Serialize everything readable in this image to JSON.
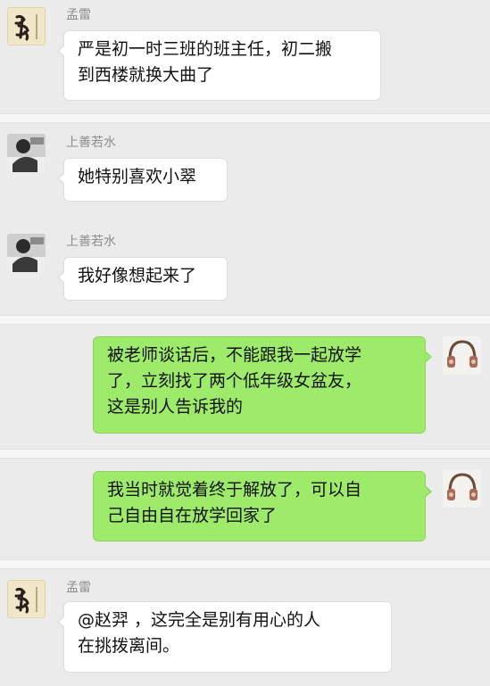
{
  "messages": [
    {
      "sender": "孟雷",
      "side": "left",
      "avatar": "calligraphy-avatar-icon",
      "lines": [
        "严是初一时三班的班主任，初二搬",
        "到西楼就换大曲了"
      ]
    },
    {
      "sender": "上善若水",
      "side": "left",
      "avatar": "photo-avatar-icon",
      "lines": [
        "她特别喜欢小翠"
      ]
    },
    {
      "sender": "上善若水",
      "side": "left",
      "avatar": "photo-avatar-icon",
      "lines": [
        "我好像想起来了"
      ]
    },
    {
      "side": "right",
      "avatar": "headphones-avatar-icon",
      "lines": [
        "被老师谈话后，不能跟我一起放学",
        "了，立刻找了两个低年级女盆友，",
        "这是别人告诉我的"
      ]
    },
    {
      "side": "right",
      "avatar": "headphones-avatar-icon",
      "lines": [
        "我当时就觉着终于解放了，可以自",
        "己自由自在放学回家了"
      ]
    },
    {
      "sender": "孟雷",
      "side": "left",
      "avatar": "calligraphy-avatar-icon",
      "lines": [
        "@赵羿 ，这完全是别有用心的人",
        "在挑拨离间。"
      ]
    }
  ],
  "colors": {
    "bubble_outgoing": "#9eea6a",
    "bubble_incoming": "#ffffff",
    "background": "#ebebeb"
  }
}
